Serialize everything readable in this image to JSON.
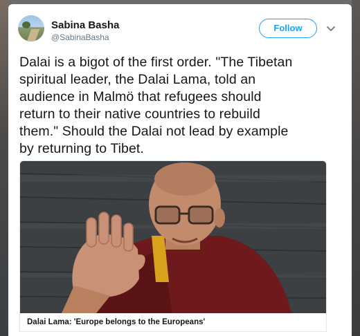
{
  "tweet": {
    "author_name": "Sabina Basha",
    "author_handle": "@SabinaBasha",
    "follow_label": "Follow",
    "text_lines": [
      "Dalai is a bigot of the first order. \"The Tibetan",
      "spiritual leader, the Dalai Lama, told an",
      "audience in Malmö that refugees should",
      "return to their native countries to rebuild",
      "them.\" Should the Dalai not lead by example",
      "by returning to Tibet."
    ],
    "media_caption": "Dalai Lama: 'Europe belongs to the Europeans'"
  },
  "icons": {
    "more": "chevron-down-icon"
  },
  "colors": {
    "accent": "#1da1f2",
    "text": "#14171a",
    "secondary_text": "#657786",
    "robe": "#6e1a1c",
    "robe_yellow": "#d9a21b"
  }
}
